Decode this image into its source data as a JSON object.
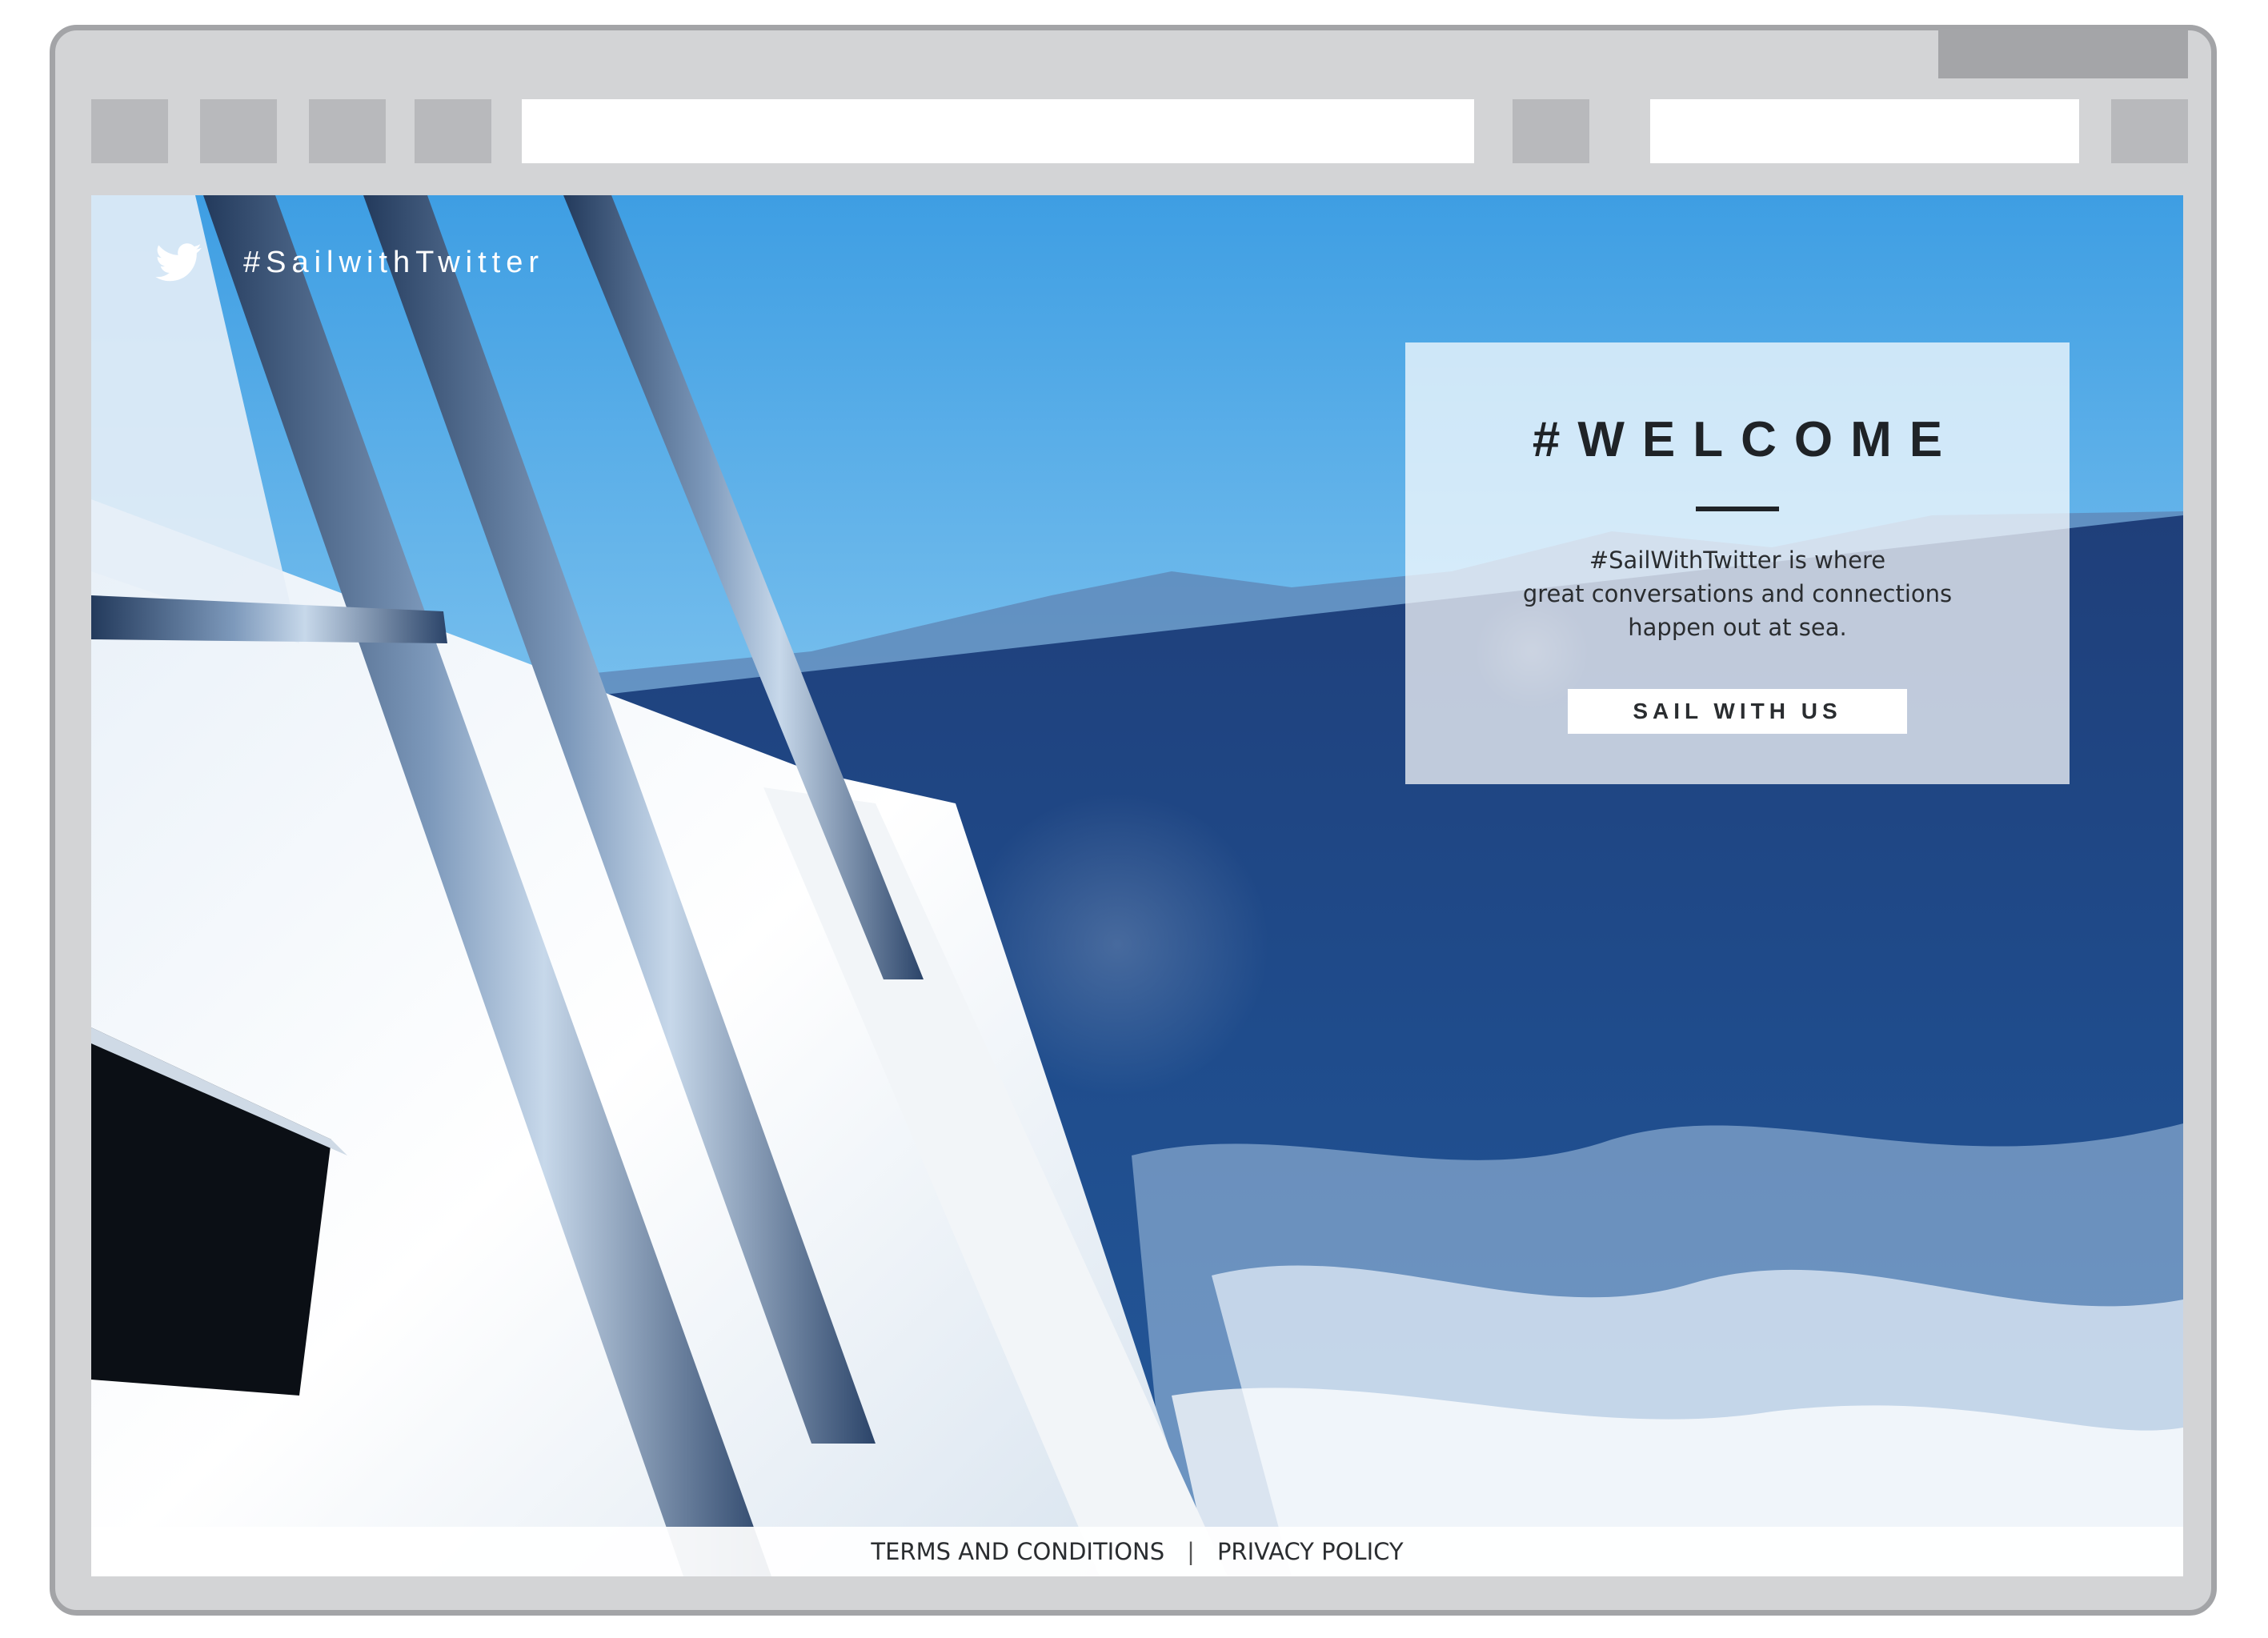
{
  "brand": {
    "hashtag": "#SailwithTwitter",
    "logo_icon": "twitter-bird-icon"
  },
  "hero": {
    "title": "#WELCOME",
    "body_lines": [
      "#SailWithTwitter is where",
      "great conversations and connections",
      "happen out at sea."
    ],
    "cta_label": "SAIL WITH US"
  },
  "footer": {
    "terms_label": "TERMS AND CONDITIONS",
    "separator": "|",
    "privacy_label": "PRIVACY POLICY"
  },
  "colors": {
    "frame": "#d3d4d6",
    "frame_border": "#a3a4a7",
    "browser_button": "#b8b9bc",
    "sky": "#5fb3ea",
    "sea": "#1d4a86",
    "text_dark": "#1f2327"
  }
}
